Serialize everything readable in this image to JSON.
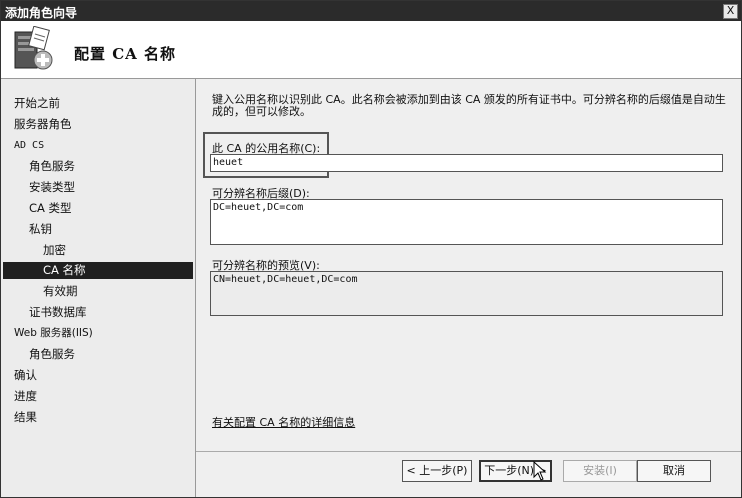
{
  "window": {
    "title": "添加角色向导",
    "close_label": "X"
  },
  "header": {
    "title": "配置 CA 名称"
  },
  "sidebar": {
    "items": [
      {
        "label": "开始之前"
      },
      {
        "label": "服务器角色"
      },
      {
        "label": "AD CS"
      },
      {
        "label": "角色服务"
      },
      {
        "label": "安装类型"
      },
      {
        "label": "CA 类型"
      },
      {
        "label": "私钥"
      },
      {
        "label": "加密"
      },
      {
        "label": "CA 名称"
      },
      {
        "label": "有效期"
      },
      {
        "label": "证书数据库"
      },
      {
        "label": "Web 服务器(IIS)"
      },
      {
        "label": "角色服务"
      },
      {
        "label": "确认"
      },
      {
        "label": "进度"
      },
      {
        "label": "结果"
      }
    ]
  },
  "main": {
    "description": "键入公用名称以识别此 CA。此名称会被添加到由该 CA 颁发的所有证书中。可分辨名称的后缀值是自动生成的，但可以修改。",
    "common_name": {
      "label": "此 CA 的公用名称(C):",
      "value": "heuet"
    },
    "dn_suffix": {
      "label": "可分辨名称后缀(D):",
      "value": "DC=heuet,DC=com"
    },
    "preview": {
      "label": "可分辨名称的预览(V):",
      "value": "CN=heuet,DC=heuet,DC=com"
    },
    "more_info_link": "有关配置 CA 名称的详细信息"
  },
  "buttons": {
    "back": "< 上一步(P)",
    "next": "下一步(N) >",
    "install": "安装(I)",
    "cancel": "取消"
  }
}
